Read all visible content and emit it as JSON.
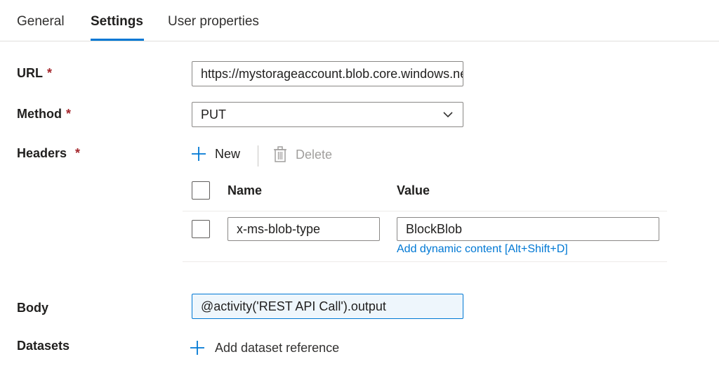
{
  "tabs": {
    "general": "General",
    "settings": "Settings",
    "user_properties": "User properties"
  },
  "form": {
    "url_label": "URL",
    "url_value": "https://mystorageaccount.blob.core.windows.net/",
    "method_label": "Method",
    "method_value": "PUT",
    "headers_label": "Headers",
    "body_label": "Body",
    "body_value": "@activity('REST API Call').output",
    "datasets_label": "Datasets",
    "required_mark": "*"
  },
  "headers_toolbar": {
    "new_label": "New",
    "delete_label": "Delete"
  },
  "headers_table": {
    "col_name": "Name",
    "col_value": "Value",
    "rows": [
      {
        "name": "x-ms-blob-type",
        "value": "BlockBlob"
      }
    ],
    "dynamic_content_link": "Add dynamic content [Alt+Shift+D]"
  },
  "datasets": {
    "add_label": "Add dataset reference"
  },
  "colors": {
    "accent": "#0078d4",
    "required": "#a4262c",
    "disabled": "#a19f9d"
  }
}
